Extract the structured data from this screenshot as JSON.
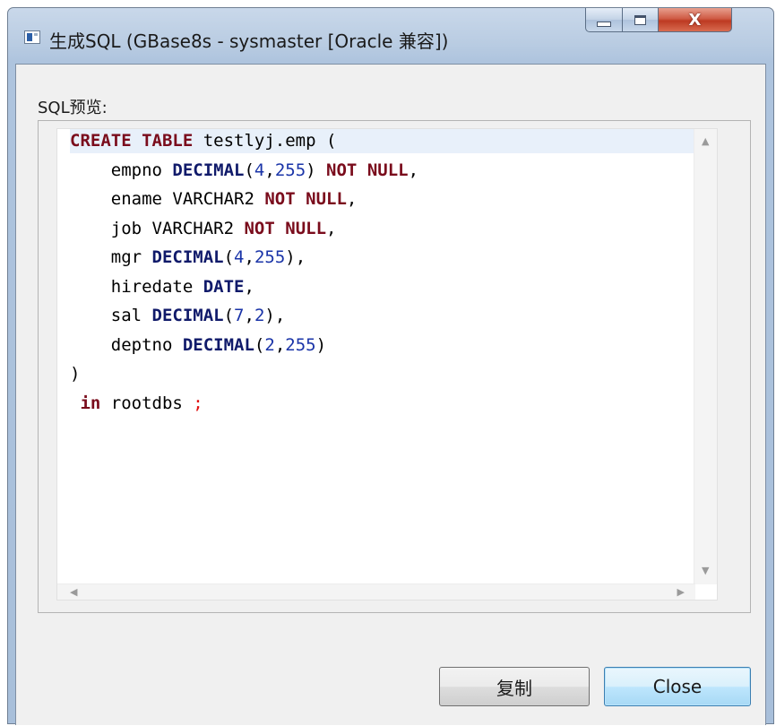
{
  "window": {
    "title": "生成SQL (GBase8s - sysmaster [Oracle 兼容])",
    "minimize_icon": "minimize-icon",
    "maximize_icon": "maximize-icon",
    "close_icon": "close-icon",
    "close_glyph": "X"
  },
  "preview": {
    "label": "SQL预览:",
    "lines": [
      [
        {
          "t": "CREATE",
          "c": "kw"
        },
        {
          "t": " "
        },
        {
          "t": "TABLE",
          "c": "kw"
        },
        {
          "t": " testlyj.emp ("
        }
      ],
      [
        {
          "t": "    empno "
        },
        {
          "t": "DECIMAL",
          "c": "kw-type"
        },
        {
          "t": "("
        },
        {
          "t": "4",
          "c": "num"
        },
        {
          "t": ","
        },
        {
          "t": "255",
          "c": "num"
        },
        {
          "t": ") "
        },
        {
          "t": "NOT",
          "c": "kw"
        },
        {
          "t": " "
        },
        {
          "t": "NULL",
          "c": "kw"
        },
        {
          "t": ","
        }
      ],
      [
        {
          "t": "    ename VARCHAR2 "
        },
        {
          "t": "NOT",
          "c": "kw"
        },
        {
          "t": " "
        },
        {
          "t": "NULL",
          "c": "kw"
        },
        {
          "t": ","
        }
      ],
      [
        {
          "t": "    job VARCHAR2 "
        },
        {
          "t": "NOT",
          "c": "kw"
        },
        {
          "t": " "
        },
        {
          "t": "NULL",
          "c": "kw"
        },
        {
          "t": ","
        }
      ],
      [
        {
          "t": "    mgr "
        },
        {
          "t": "DECIMAL",
          "c": "kw-type"
        },
        {
          "t": "("
        },
        {
          "t": "4",
          "c": "num"
        },
        {
          "t": ","
        },
        {
          "t": "255",
          "c": "num"
        },
        {
          "t": "),"
        }
      ],
      [
        {
          "t": "    hiredate "
        },
        {
          "t": "DATE",
          "c": "kw-type"
        },
        {
          "t": ","
        }
      ],
      [
        {
          "t": "    sal "
        },
        {
          "t": "DECIMAL",
          "c": "kw-type"
        },
        {
          "t": "("
        },
        {
          "t": "7",
          "c": "num"
        },
        {
          "t": ","
        },
        {
          "t": "2",
          "c": "num"
        },
        {
          "t": "),"
        }
      ],
      [
        {
          "t": "    deptno "
        },
        {
          "t": "DECIMAL",
          "c": "kw-type"
        },
        {
          "t": "("
        },
        {
          "t": "2",
          "c": "num"
        },
        {
          "t": ","
        },
        {
          "t": "255",
          "c": "num"
        },
        {
          "t": ")"
        }
      ],
      [
        {
          "t": ")"
        }
      ],
      [
        {
          "t": " "
        },
        {
          "t": "in",
          "c": "kw"
        },
        {
          "t": " rootdbs "
        },
        {
          "t": ";",
          "c": "semi"
        }
      ]
    ],
    "scroll_up_icon": "scroll-up-arrow-icon",
    "scroll_down_icon": "scroll-down-arrow-icon",
    "scroll_left_icon": "scroll-left-arrow-icon",
    "scroll_right_icon": "scroll-right-arrow-icon"
  },
  "buttons": {
    "copy_label": "复制",
    "close_label": "Close"
  },
  "colors": {
    "keyword": "#7a0c1c",
    "type_keyword": "#101a6a",
    "number": "#1a34a8",
    "semicolon": "#e01010",
    "current_line": "#e8f0fa"
  }
}
